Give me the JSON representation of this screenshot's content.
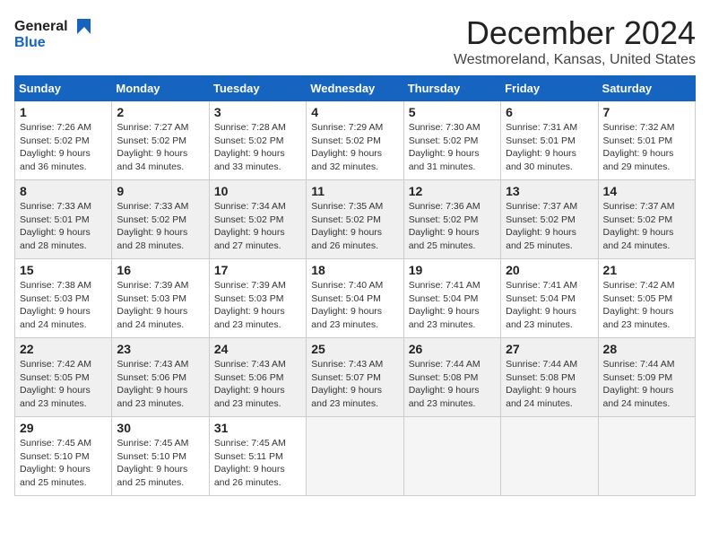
{
  "logo": {
    "line1": "General",
    "line2": "Blue"
  },
  "title": "December 2024",
  "subtitle": "Westmoreland, Kansas, United States",
  "days_of_week": [
    "Sunday",
    "Monday",
    "Tuesday",
    "Wednesday",
    "Thursday",
    "Friday",
    "Saturday"
  ],
  "weeks": [
    [
      {
        "day": "1",
        "sunrise": "7:26 AM",
        "sunset": "5:02 PM",
        "daylight": "9 hours and 36 minutes."
      },
      {
        "day": "2",
        "sunrise": "7:27 AM",
        "sunset": "5:02 PM",
        "daylight": "9 hours and 34 minutes."
      },
      {
        "day": "3",
        "sunrise": "7:28 AM",
        "sunset": "5:02 PM",
        "daylight": "9 hours and 33 minutes."
      },
      {
        "day": "4",
        "sunrise": "7:29 AM",
        "sunset": "5:02 PM",
        "daylight": "9 hours and 32 minutes."
      },
      {
        "day": "5",
        "sunrise": "7:30 AM",
        "sunset": "5:02 PM",
        "daylight": "9 hours and 31 minutes."
      },
      {
        "day": "6",
        "sunrise": "7:31 AM",
        "sunset": "5:01 PM",
        "daylight": "9 hours and 30 minutes."
      },
      {
        "day": "7",
        "sunrise": "7:32 AM",
        "sunset": "5:01 PM",
        "daylight": "9 hours and 29 minutes."
      }
    ],
    [
      {
        "day": "8",
        "sunrise": "7:33 AM",
        "sunset": "5:01 PM",
        "daylight": "9 hours and 28 minutes."
      },
      {
        "day": "9",
        "sunrise": "7:33 AM",
        "sunset": "5:02 PM",
        "daylight": "9 hours and 28 minutes."
      },
      {
        "day": "10",
        "sunrise": "7:34 AM",
        "sunset": "5:02 PM",
        "daylight": "9 hours and 27 minutes."
      },
      {
        "day": "11",
        "sunrise": "7:35 AM",
        "sunset": "5:02 PM",
        "daylight": "9 hours and 26 minutes."
      },
      {
        "day": "12",
        "sunrise": "7:36 AM",
        "sunset": "5:02 PM",
        "daylight": "9 hours and 25 minutes."
      },
      {
        "day": "13",
        "sunrise": "7:37 AM",
        "sunset": "5:02 PM",
        "daylight": "9 hours and 25 minutes."
      },
      {
        "day": "14",
        "sunrise": "7:37 AM",
        "sunset": "5:02 PM",
        "daylight": "9 hours and 24 minutes."
      }
    ],
    [
      {
        "day": "15",
        "sunrise": "7:38 AM",
        "sunset": "5:03 PM",
        "daylight": "9 hours and 24 minutes."
      },
      {
        "day": "16",
        "sunrise": "7:39 AM",
        "sunset": "5:03 PM",
        "daylight": "9 hours and 24 minutes."
      },
      {
        "day": "17",
        "sunrise": "7:39 AM",
        "sunset": "5:03 PM",
        "daylight": "9 hours and 23 minutes."
      },
      {
        "day": "18",
        "sunrise": "7:40 AM",
        "sunset": "5:04 PM",
        "daylight": "9 hours and 23 minutes."
      },
      {
        "day": "19",
        "sunrise": "7:41 AM",
        "sunset": "5:04 PM",
        "daylight": "9 hours and 23 minutes."
      },
      {
        "day": "20",
        "sunrise": "7:41 AM",
        "sunset": "5:04 PM",
        "daylight": "9 hours and 23 minutes."
      },
      {
        "day": "21",
        "sunrise": "7:42 AM",
        "sunset": "5:05 PM",
        "daylight": "9 hours and 23 minutes."
      }
    ],
    [
      {
        "day": "22",
        "sunrise": "7:42 AM",
        "sunset": "5:05 PM",
        "daylight": "9 hours and 23 minutes."
      },
      {
        "day": "23",
        "sunrise": "7:43 AM",
        "sunset": "5:06 PM",
        "daylight": "9 hours and 23 minutes."
      },
      {
        "day": "24",
        "sunrise": "7:43 AM",
        "sunset": "5:06 PM",
        "daylight": "9 hours and 23 minutes."
      },
      {
        "day": "25",
        "sunrise": "7:43 AM",
        "sunset": "5:07 PM",
        "daylight": "9 hours and 23 minutes."
      },
      {
        "day": "26",
        "sunrise": "7:44 AM",
        "sunset": "5:08 PM",
        "daylight": "9 hours and 23 minutes."
      },
      {
        "day": "27",
        "sunrise": "7:44 AM",
        "sunset": "5:08 PM",
        "daylight": "9 hours and 24 minutes."
      },
      {
        "day": "28",
        "sunrise": "7:44 AM",
        "sunset": "5:09 PM",
        "daylight": "9 hours and 24 minutes."
      }
    ],
    [
      {
        "day": "29",
        "sunrise": "7:45 AM",
        "sunset": "5:10 PM",
        "daylight": "9 hours and 25 minutes."
      },
      {
        "day": "30",
        "sunrise": "7:45 AM",
        "sunset": "5:10 PM",
        "daylight": "9 hours and 25 minutes."
      },
      {
        "day": "31",
        "sunrise": "7:45 AM",
        "sunset": "5:11 PM",
        "daylight": "9 hours and 26 minutes."
      },
      null,
      null,
      null,
      null
    ]
  ],
  "labels": {
    "sunrise": "Sunrise:",
    "sunset": "Sunset:",
    "daylight": "Daylight:"
  }
}
